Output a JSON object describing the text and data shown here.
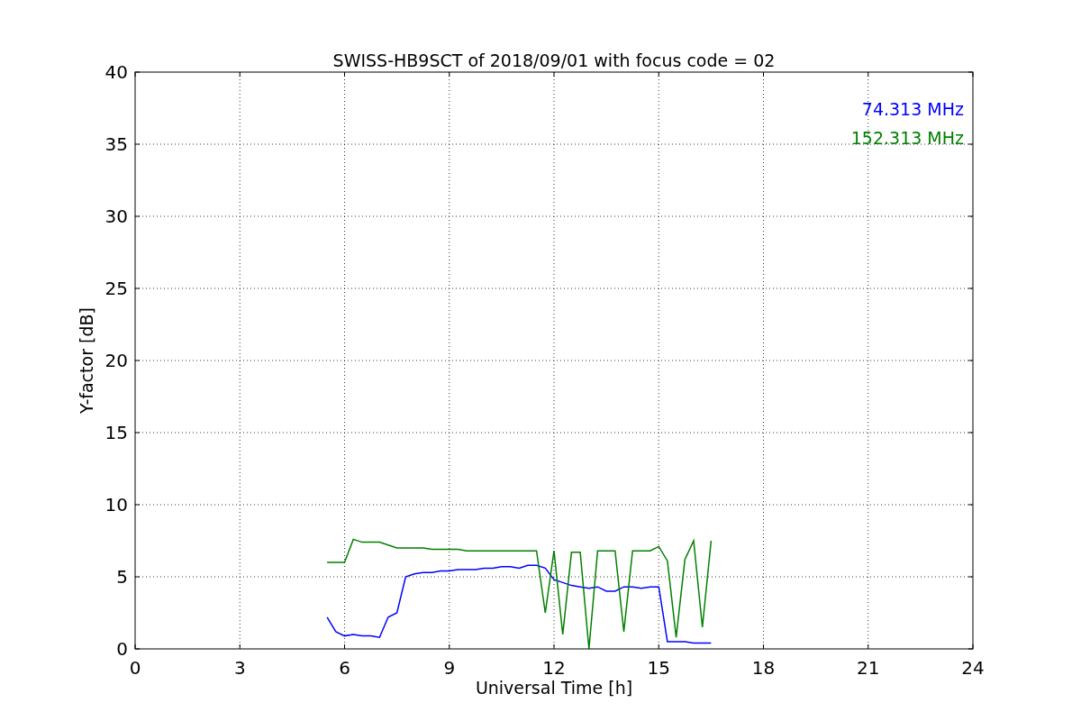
{
  "chart": {
    "chart_data": {
      "type": "line",
      "title": "SWISS-HB9SCT of 2018/09/01 with focus code = 02",
      "xlabel": "Universal Time [h]",
      "ylabel": "Y-factor [dB]",
      "x": [
        5.5,
        5.75,
        6,
        6.25,
        6.5,
        6.75,
        7,
        7.25,
        7.5,
        7.75,
        8,
        8.25,
        8.5,
        8.75,
        9,
        9.25,
        9.5,
        9.75,
        10,
        10.25,
        10.5,
        10.75,
        11,
        11.25,
        11.5,
        11.75,
        12,
        12.25,
        12.5,
        12.75,
        13,
        13.25,
        13.5,
        13.75,
        14,
        14.25,
        14.5,
        14.75,
        15,
        15.25,
        15.5,
        15.75,
        16,
        16.25,
        16.5
      ],
      "series": [
        {
          "name": "74.313 MHz",
          "color": "#0000ff",
          "values": [
            2.2,
            1.2,
            0.9,
            1.0,
            0.9,
            0.9,
            0.8,
            2.2,
            2.5,
            5.0,
            5.2,
            5.3,
            5.3,
            5.4,
            5.4,
            5.5,
            5.5,
            5.5,
            5.6,
            5.6,
            5.7,
            5.7,
            5.6,
            5.8,
            5.8,
            5.6,
            4.8,
            4.6,
            4.4,
            4.3,
            4.2,
            4.3,
            4.0,
            4.0,
            4.3,
            4.3,
            4.2,
            4.3,
            4.3,
            0.5,
            0.5,
            0.5,
            0.4,
            0.4,
            0.4
          ]
        },
        {
          "name": "152.313 MHz",
          "color": "#008000",
          "values": [
            6.0,
            6.0,
            6.0,
            7.6,
            7.4,
            7.4,
            7.4,
            7.2,
            7.0,
            7.0,
            7.0,
            7.0,
            6.9,
            6.9,
            6.9,
            6.9,
            6.8,
            6.8,
            6.8,
            6.8,
            6.8,
            6.8,
            6.8,
            6.8,
            6.8,
            2.5,
            6.8,
            1.0,
            6.7,
            6.7,
            0.0,
            6.8,
            6.8,
            6.8,
            1.2,
            6.8,
            6.8,
            6.8,
            7.1,
            6.1,
            0.8,
            6.2,
            7.5,
            1.5,
            7.5
          ]
        }
      ],
      "xlim": [
        0,
        24
      ],
      "ylim": [
        0,
        40
      ],
      "xticks": [
        0,
        3,
        6,
        9,
        12,
        15,
        18,
        21,
        24
      ],
      "yticks": [
        0,
        5,
        10,
        15,
        20,
        25,
        30,
        35,
        40
      ],
      "grid": true
    }
  }
}
